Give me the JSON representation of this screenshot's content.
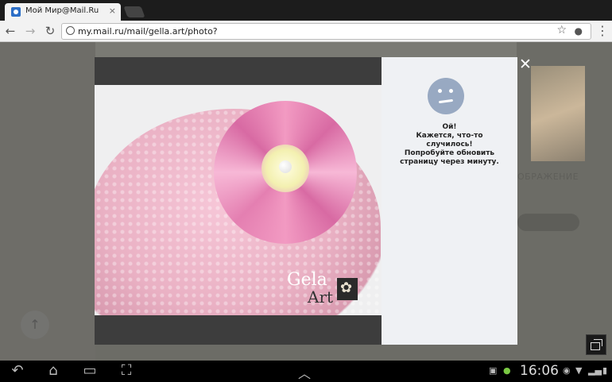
{
  "browser": {
    "tab_title": "Мой Мир@Mail.Ru",
    "tab_close": "×",
    "url": "my.mail.ru/mail/gella.art/photo?",
    "menu_glyph": "⋮"
  },
  "icons": {
    "back": "arrow-left-icon",
    "forward": "arrow-right-icon",
    "reload": "reload-icon",
    "star": "star-icon",
    "mic": "mic-icon"
  },
  "glyphs": {
    "back": "←",
    "forward": "→",
    "reload": "↻",
    "star": "☆",
    "mic": "🎤",
    "close": "✕",
    "scroll_top": "↑"
  },
  "background_page": {
    "heading": "ОБРАЖЕНИЕ"
  },
  "photo": {
    "watermark_line1": "Gela",
    "watermark_line2": "Art"
  },
  "error_panel": {
    "line1": "Ой!",
    "line2": "Кажется, что-то",
    "line3": "случилось!",
    "line4": "Попробуйте обновить",
    "line5": "страницу через минуту."
  },
  "system_bar": {
    "clock": "16:06",
    "glyph_back": "↶",
    "glyph_home": "⌂",
    "glyph_recent": "▭",
    "glyph_screenshot": "⛶",
    "glyph_up": "︿"
  },
  "colors": {
    "page_overlay": "#6c6c66",
    "error_panel_bg": "#eff1f4",
    "sad_face": "#98a9c2"
  }
}
